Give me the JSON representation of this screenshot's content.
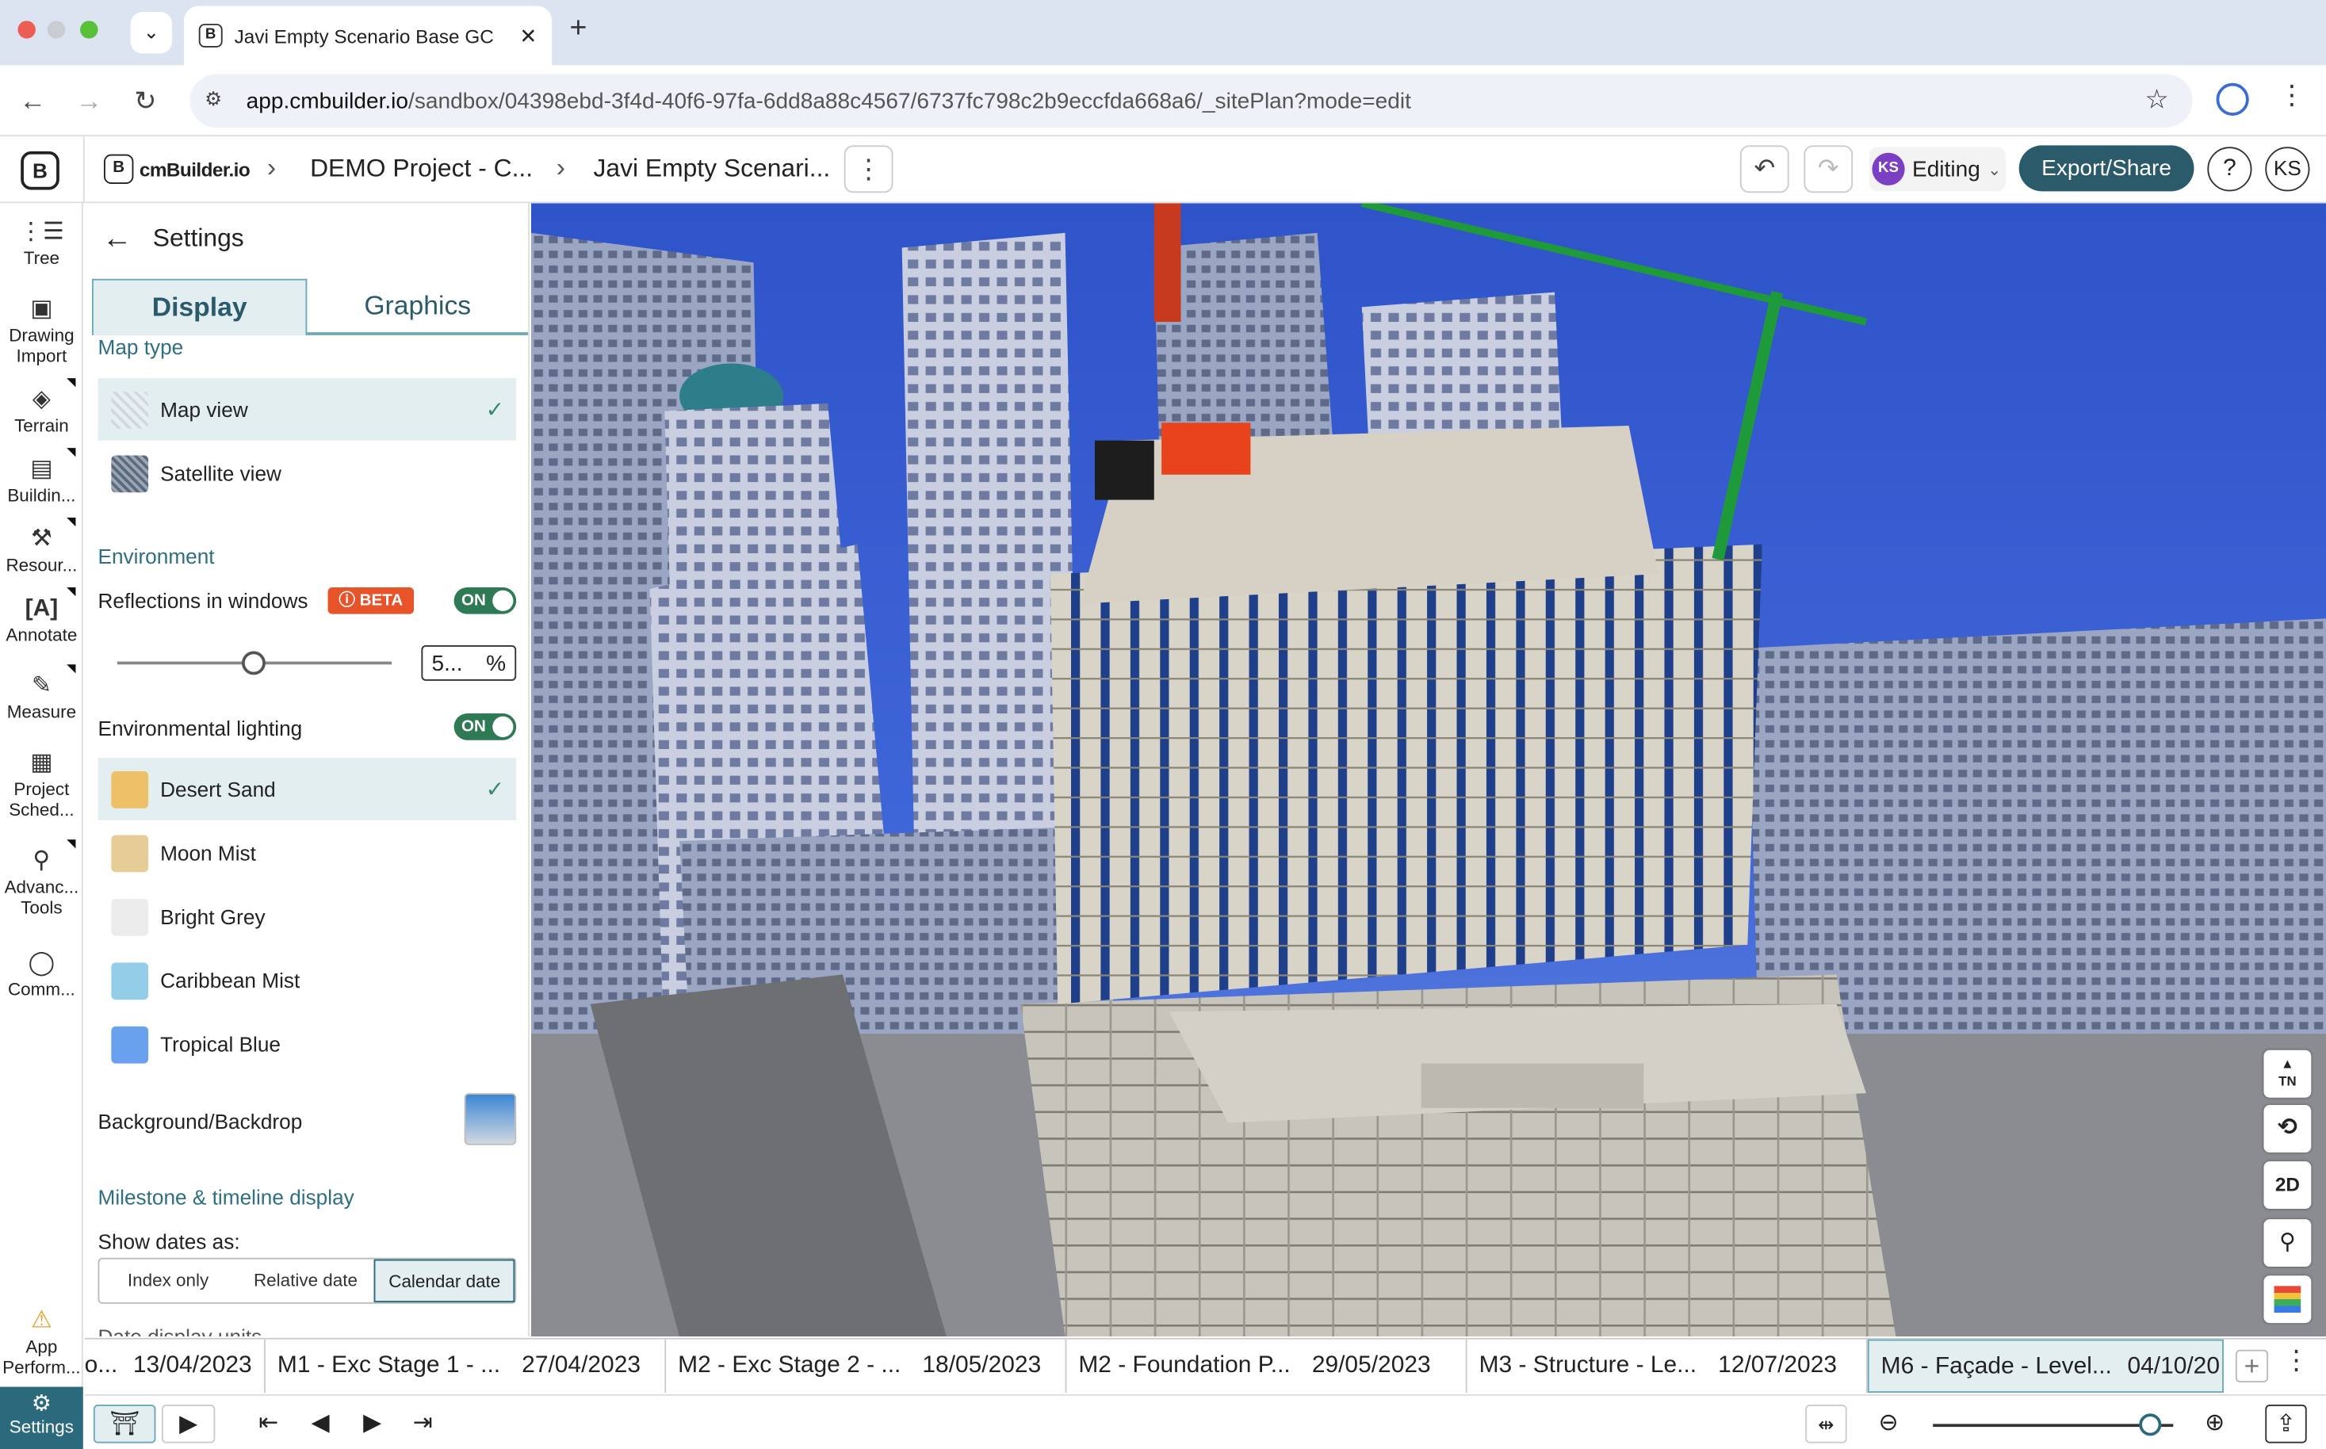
{
  "browser": {
    "tab_title": "Javi Empty Scenario Base GC",
    "url_host": "app.cmbuilder.io",
    "url_path": "/sandbox/04398ebd-3f4d-40f6-97fa-6dd8a88c4567/6737fc798c2b9eccfda668a6/_sitePlan?mode=edit"
  },
  "header": {
    "logo_text": "cmBuilder.io",
    "crumb_project": "DEMO Project - C...",
    "crumb_scenario": "Javi Empty Scenari...",
    "avatar_initials": "KS",
    "mode_label": "Editing",
    "export_label": "Export/Share",
    "help_label": "?",
    "user_initials": "KS"
  },
  "rail": {
    "items": [
      {
        "label": "Tree"
      },
      {
        "label": "Drawing Import"
      },
      {
        "label": "Terrain"
      },
      {
        "label": "Buildin..."
      },
      {
        "label": "Resour..."
      },
      {
        "label": "Annotate"
      },
      {
        "label": "Measure"
      },
      {
        "label": "Project Sched..."
      },
      {
        "label": "Advanc... Tools"
      },
      {
        "label": "Comm..."
      },
      {
        "label": "App Perform..."
      },
      {
        "label": "Settings"
      }
    ]
  },
  "settings": {
    "title": "Settings",
    "tabs": {
      "display": "Display",
      "graphics": "Graphics"
    },
    "map_type": {
      "heading": "Map type",
      "options": [
        {
          "label": "Map view",
          "selected": true
        },
        {
          "label": "Satellite view",
          "selected": false
        }
      ]
    },
    "environment": {
      "heading": "Environment",
      "reflections_label": "Reflections in windows",
      "beta_label": "BETA",
      "reflections_toggle": "ON",
      "reflection_value": "5...",
      "percent_unit": "%",
      "reflection_level": 0.5,
      "lighting_label": "Environmental lighting",
      "lighting_toggle": "ON",
      "lighting_options": [
        {
          "label": "Desert Sand",
          "color": "#eec068",
          "selected": true
        },
        {
          "label": "Moon Mist",
          "color": "#e6cd98",
          "selected": false
        },
        {
          "label": "Bright Grey",
          "color": "#ececec",
          "selected": false
        },
        {
          "label": "Caribbean Mist",
          "color": "#93cde8",
          "selected": false
        },
        {
          "label": "Tropical Blue",
          "color": "#6aa1ee",
          "selected": false
        }
      ],
      "backdrop_label": "Background/Backdrop"
    },
    "milestone": {
      "heading": "Milestone & timeline display",
      "show_dates_label": "Show dates as:",
      "modes": [
        "Index only",
        "Relative date",
        "Calendar date"
      ],
      "selected_mode": "Calendar date",
      "cut_label": "Date display units"
    }
  },
  "viewport_controls": [
    "TN",
    "2D"
  ],
  "timeline": {
    "items": [
      {
        "label": "o...",
        "date": "13/04/2023"
      },
      {
        "label": "M1 - Exc Stage 1 - ...",
        "date": "27/04/2023"
      },
      {
        "label": "M2 - Exc Stage 2 - ...",
        "date": "18/05/2023"
      },
      {
        "label": "M2 - Foundation P...",
        "date": "29/05/2023"
      },
      {
        "label": "M3 - Structure - Le...",
        "date": "12/07/2023"
      },
      {
        "label": "M6 - Façade - Level...",
        "date": "04/10/20"
      }
    ],
    "active_index": 5,
    "zoom_level": 0.9
  },
  "colors": {
    "accent": "#2b5b6b",
    "beta": "#e8542a",
    "toggle_on": "#2e7a55"
  }
}
